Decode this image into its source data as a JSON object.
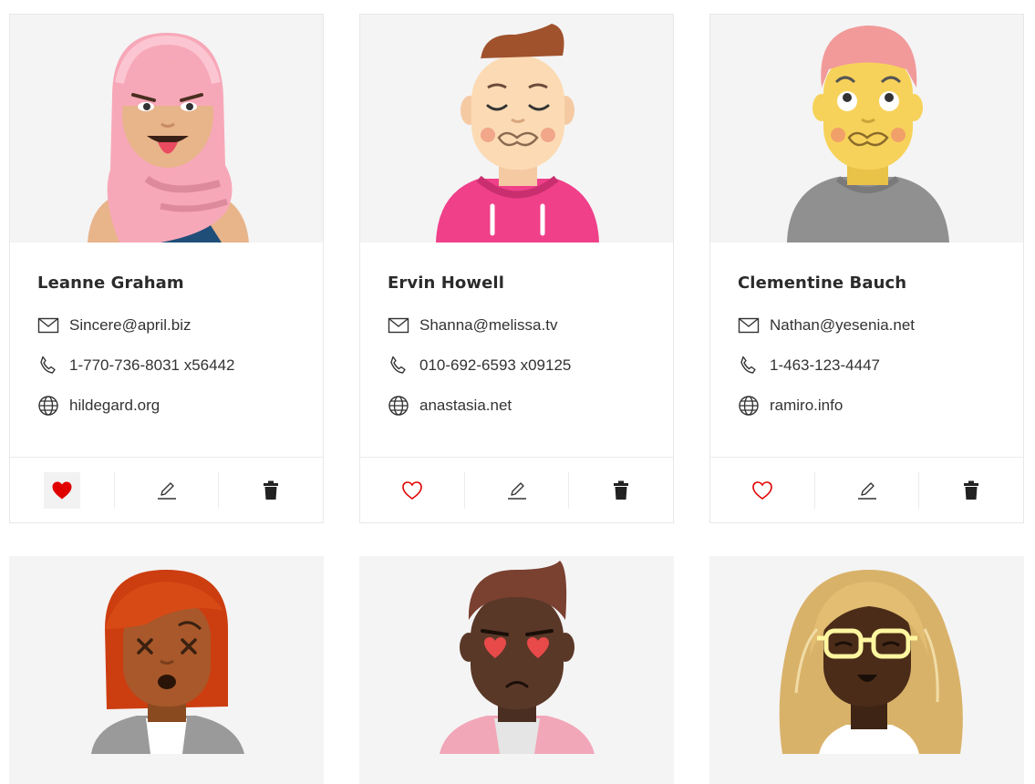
{
  "colors": {
    "heart": "#e00000",
    "icon": "#333333",
    "card_border": "#e8e8e8",
    "avatar_bg": "#f4f4f4"
  },
  "users": [
    {
      "name": "Leanne Graham",
      "email": "Sincere@april.biz",
      "phone": "1-770-736-8031 x56442",
      "website": "hildegard.org",
      "liked": true,
      "avatar": "hijab-tongue"
    },
    {
      "name": "Ervin Howell",
      "email": "Shanna@melissa.tv",
      "phone": "010-692-6593 x09125",
      "website": "anastasia.net",
      "liked": false,
      "avatar": "blond-sick"
    },
    {
      "name": "Clementine Bauch",
      "email": "Nathan@yesenia.net",
      "phone": "1-463-123-4447",
      "website": "ramiro.info",
      "liked": false,
      "avatar": "yellow-puffy"
    },
    {
      "avatar": "redhair-dizzy"
    },
    {
      "avatar": "dark-hearteyes"
    },
    {
      "avatar": "curly-glasses"
    }
  ],
  "icons": {
    "email": "mail-icon",
    "phone": "phone-icon",
    "website": "globe-icon",
    "like": "heart-icon",
    "edit": "pencil-icon",
    "delete": "trash-icon"
  }
}
